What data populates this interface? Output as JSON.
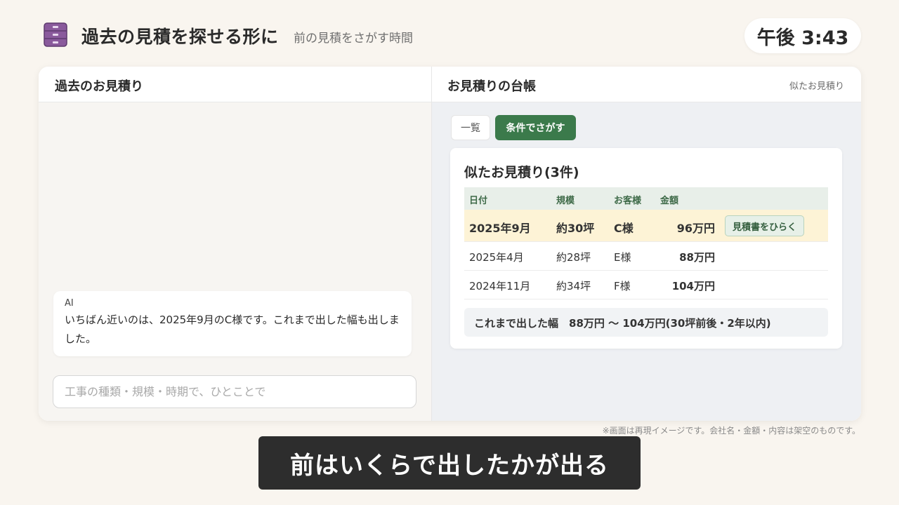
{
  "header": {
    "title": "過去の見積を探せる形に",
    "subtitle": "前の見積をさがす時間",
    "clock": "午後 3:43"
  },
  "left_pane": {
    "title": "過去のお見積り",
    "ai_message": {
      "sender": "AI",
      "text": "いちばん近いのは、2025年9月のC様です。これまで出した幅も出しました。"
    },
    "input": {
      "value": "",
      "placeholder": "工事の種類・規模・時期で、ひとことで"
    }
  },
  "right_pane": {
    "title": "お見積りの台帳",
    "link": "似たお見積り",
    "tabs": [
      {
        "label": "一覧",
        "active": false
      },
      {
        "label": "条件でさがす",
        "active": true
      }
    ],
    "results": {
      "title": "似たお見積り(3件)",
      "columns": [
        "日付",
        "規模",
        "お客様",
        "金額"
      ],
      "rows": [
        {
          "date": "2025年9月",
          "size": "約30坪",
          "customer": "C様",
          "amount": "96万円",
          "highlight": true,
          "action": "見積書をひらく"
        },
        {
          "date": "2025年4月",
          "size": "約28坪",
          "customer": "E様",
          "amount": "88万円",
          "highlight": false
        },
        {
          "date": "2024年11月",
          "size": "約34坪",
          "customer": "F様",
          "amount": "104万円",
          "highlight": false
        }
      ],
      "range_text": "これまで出した幅　88万円 〜 104万円(30坪前後・2年以内)"
    }
  },
  "disclaimer": "※画面は再現イメージです。会社名・金額・内容は架空のものです。",
  "caption": "前はいくらで出したかが出る",
  "colors": {
    "accent_green": "#3b7a4b",
    "highlight_row": "#fdf3d6",
    "app_icon": "#8a5a9c"
  },
  "icons": {
    "app": "file-cabinet-icon"
  }
}
